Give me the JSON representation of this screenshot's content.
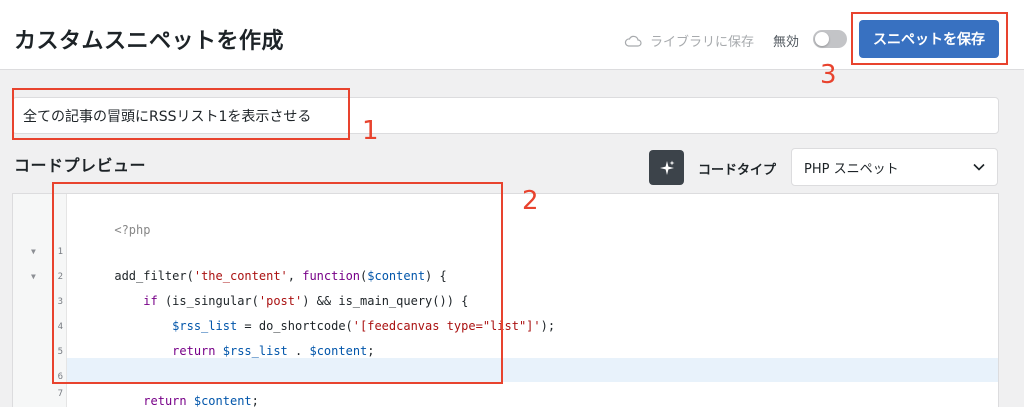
{
  "header": {
    "title": "カスタムスニペットを作成",
    "save_to_library": "ライブラリに保存",
    "disabled_label": "無効",
    "save_button": "スニペットを保存"
  },
  "snippet": {
    "title_value": "全ての記事の冒頭にRSSリスト1を表示させる"
  },
  "code_preview": {
    "section_title": "コードプレビュー",
    "code_type_label": "コードタイプ",
    "code_type_value": "PHP スニペット"
  },
  "editor": {
    "opening_tag": "<?php",
    "lines": [
      {
        "num": "1",
        "fold": "▼"
      },
      {
        "num": "2",
        "fold": "▼"
      },
      {
        "num": "3",
        "fold": ""
      },
      {
        "num": "4",
        "fold": ""
      },
      {
        "num": "5",
        "fold": ""
      },
      {
        "num": "6",
        "fold": ""
      },
      {
        "num": "7",
        "fold": ""
      }
    ],
    "tokens": {
      "l1_fn": "add_filter(",
      "l1_str": "'the_content'",
      "l1_mid": ", ",
      "l1_kw": "function",
      "l1_open": "(",
      "l1_var": "$content",
      "l1_end": ") {",
      "l2_kw": "if",
      "l2_a": " (is_singular(",
      "l2_str": "'post'",
      "l2_b": ") && is_main_query()) {",
      "l3_var": "$rss_list",
      "l3_a": " = do_shortcode(",
      "l3_str": "'[feedcanvas type=\"list\"]'",
      "l3_b": ");",
      "l4_kw": "return",
      "l4_var1": "$rss_list",
      "l4_a": " . ",
      "l4_var2": "$content",
      "l4_b": ";",
      "l5": "}",
      "l6_kw": "return",
      "l6_var": "$content",
      "l6_b": ";",
      "l7": "});"
    }
  },
  "annotations": {
    "n1": "1",
    "n2": "2",
    "n3": "3"
  },
  "colors": {
    "primary_button": "#3871c1",
    "annotation": "#e8432e",
    "active_line": "#e8f2fb"
  },
  "icons": {
    "cloud": "cloud-icon",
    "sparkle": "sparkle-icon",
    "chevron": "chevron-down-icon"
  }
}
